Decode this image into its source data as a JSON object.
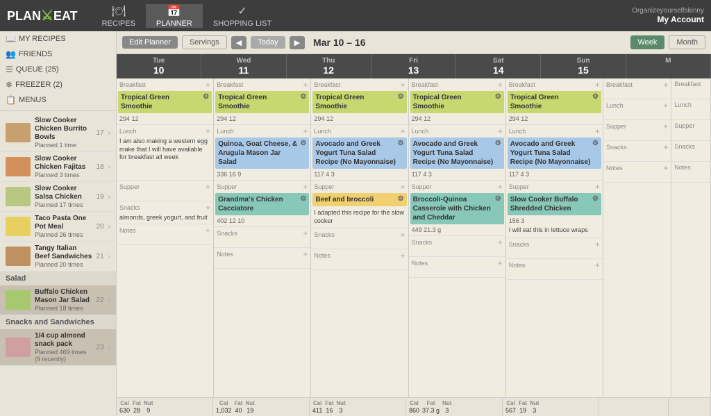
{
  "header": {
    "logo": "PLAN TO EAT",
    "nav": [
      {
        "label": "RECIPES",
        "icon": "🍽"
      },
      {
        "label": "PLANNER",
        "icon": "📅"
      },
      {
        "label": "SHOPPING LIST",
        "icon": "✓"
      }
    ],
    "account": {
      "site": "Organizeyourselfskinny",
      "label": "My Account"
    }
  },
  "toolbar": {
    "edit_planner": "Edit Planner",
    "servings": "Servings",
    "prev": "◀",
    "today": "Today",
    "next": "▶",
    "date_range": "Mar 10 – 16",
    "week": "Week",
    "month": "Month"
  },
  "sidebar": {
    "my_recipes": "MY RECIPES",
    "friends": "FRIENDS",
    "queue": "QUEUE (25)",
    "freezer": "FREEZER (2)",
    "menus": "MENUS",
    "recipes": [
      {
        "name": "Slow Cooker Chicken Burrito Bowls",
        "planned": "Planned 1 time",
        "num": "17",
        "thumb": "t1"
      },
      {
        "name": "Slow Cooker Chicken Fajitas",
        "planned": "Planned 3 times",
        "num": "18",
        "thumb": "t2"
      },
      {
        "name": "Slow Cooker Salsa Chicken",
        "planned": "Planned 17 times",
        "num": "19",
        "thumb": "t3"
      },
      {
        "name": "Taco Pasta One Pot Meal",
        "planned": "Planned 26 times",
        "num": "20",
        "thumb": "t4"
      },
      {
        "name": "Tangy Italian Beef Sandwiches",
        "planned": "Planned 20 times",
        "num": "21",
        "thumb": "t5"
      }
    ],
    "salad_section": "Salad",
    "salad_recipes": [
      {
        "name": "Buffalo Chicken Mason Jar Salad",
        "planned": "Planned 18 times",
        "num": "22",
        "thumb": "t6"
      }
    ],
    "snacks_section": "Snacks and Sandwiches",
    "snacks_recipes": [
      {
        "name": "1/4 cup almond snack pack",
        "planned": "Planned 469 times\n(9 recently)",
        "num": "23",
        "thumb": "t7"
      }
    ]
  },
  "days": [
    {
      "name": "Tue",
      "num": "10",
      "meals": {
        "breakfast": {
          "items": [
            {
              "name": "Tropical Green Smoothie",
              "color": "green",
              "stats": "294  12"
            }
          ],
          "note": ""
        },
        "lunch": {
          "items": [],
          "note": "I am also making a western egg make that I will have available for breakfast all week"
        },
        "supper": {
          "items": [],
          "note": ""
        },
        "snacks": {
          "items": [],
          "note": "almonds, greek yogurt, and fruit"
        }
      },
      "footer": {
        "cal": "630",
        "fat": "28",
        "nut": "9"
      }
    },
    {
      "name": "Wed",
      "num": "11",
      "meals": {
        "breakfast": {
          "items": [
            {
              "name": "Tropical Green Smoothie",
              "color": "green",
              "stats": "294  12"
            }
          ],
          "note": ""
        },
        "lunch": {
          "items": [
            {
              "name": "Quinoa, Goat Cheese, & Arugula Mason Jar Salad",
              "color": "blue",
              "stats": "336  16  9"
            }
          ],
          "note": ""
        },
        "supper": {
          "items": [
            {
              "name": "Grandma's Chicken Cacciatore",
              "color": "teal",
              "stats": "402  12  10"
            }
          ],
          "note": ""
        },
        "snacks": {
          "items": [],
          "note": ""
        }
      },
      "footer": {
        "cal": "1,032",
        "fat": "40",
        "nut": "19"
      }
    },
    {
      "name": "Thu",
      "num": "12",
      "meals": {
        "breakfast": {
          "items": [
            {
              "name": "Tropical Green Smoothie",
              "color": "green",
              "stats": "294  12"
            }
          ],
          "note": ""
        },
        "lunch": {
          "items": [
            {
              "name": "Avocado and Greek Yogurt Tuna Salad Recipe (No Mayonnaise)",
              "color": "blue",
              "stats": "117  4  3"
            }
          ],
          "note": ""
        },
        "supper": {
          "items": [
            {
              "name": "Beef and broccoli",
              "color": "yellow",
              "stats": ""
            }
          ],
          "note": "I adapted this recipe for the slow cooker"
        },
        "snacks": {
          "items": [],
          "note": ""
        }
      },
      "footer": {
        "cal": "411",
        "fat": "16",
        "nut": "3"
      }
    },
    {
      "name": "Fri",
      "num": "13",
      "meals": {
        "breakfast": {
          "items": [
            {
              "name": "Tropical Green Smoothie",
              "color": "green",
              "stats": "294  12"
            }
          ],
          "note": ""
        },
        "lunch": {
          "items": [
            {
              "name": "Avocado and Greek Yogurt Tuna Salad Recipe (No Mayonnaise)",
              "color": "blue",
              "stats": "117  4  3"
            }
          ],
          "note": ""
        },
        "supper": {
          "items": [
            {
              "name": "Broccoli-Quinoa Casserole with Chicken and Cheddar",
              "color": "teal",
              "stats": "449  21.3 g"
            }
          ],
          "note": ""
        },
        "snacks": {
          "items": [],
          "note": ""
        }
      },
      "footer": {
        "cal": "860",
        "fat": "37.3 g",
        "nut": "3"
      }
    },
    {
      "name": "Sat",
      "num": "14",
      "meals": {
        "breakfast": {
          "items": [
            {
              "name": "Tropical Green Smoothie",
              "color": "green",
              "stats": "294  12"
            }
          ],
          "note": ""
        },
        "lunch": {
          "items": [
            {
              "name": "Avocado and Greek Yogurt Tuna Salad Recipe (No Mayonnaise)",
              "color": "blue",
              "stats": "117  4  3"
            }
          ],
          "note": ""
        },
        "supper": {
          "items": [
            {
              "name": "Slow Cooker Buffalo Shredded Chicken",
              "color": "teal",
              "stats": "156  3"
            }
          ],
          "note": "I will eat this in lettuce wraps"
        },
        "snacks": {
          "items": [],
          "note": ""
        }
      },
      "footer": {
        "cal": "567",
        "fat": "19",
        "nut": "3"
      }
    },
    {
      "name": "Sun",
      "num": "15",
      "meals": {
        "breakfast": {
          "items": [],
          "note": ""
        },
        "lunch": {
          "items": [],
          "note": ""
        },
        "supper": {
          "items": [],
          "note": ""
        },
        "snacks": {
          "items": [],
          "note": ""
        }
      },
      "footer": {
        "cal": "",
        "fat": "",
        "nut": ""
      }
    },
    {
      "name": "M",
      "num": "",
      "meals": {
        "breakfast": {
          "items": [],
          "note": ""
        },
        "lunch": {
          "items": [],
          "note": ""
        },
        "supper": {
          "items": [],
          "note": ""
        },
        "snacks": {
          "items": [],
          "note": ""
        }
      },
      "footer": {
        "cal": "",
        "fat": "",
        "nut": ""
      }
    }
  ]
}
